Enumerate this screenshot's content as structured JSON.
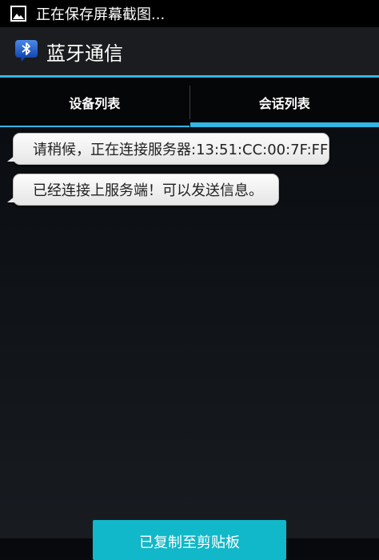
{
  "status_bar": {
    "notification_icon": "image-icon",
    "text": "正在保存屏幕截图..."
  },
  "action_bar": {
    "app_icon": "bluetooth-icon",
    "title": "蓝牙通信"
  },
  "tabs": [
    {
      "label": "设备列表",
      "selected": false
    },
    {
      "label": "会话列表",
      "selected": true
    }
  ],
  "messages": [
    {
      "text": "请稍候，正在连接服务器:13:51:CC:00:7F:FF"
    },
    {
      "text": "已经连接上服务端！可以发送信息。"
    }
  ],
  "toast": {
    "text": "已复制至剪贴板"
  },
  "colors": {
    "accent": "#33b5e5",
    "toast": "#10b8c9"
  }
}
